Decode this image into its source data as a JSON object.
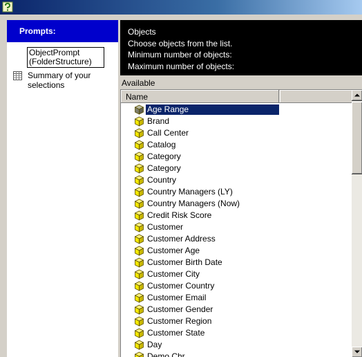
{
  "window": {
    "icon": "help-app-icon"
  },
  "sidebar": {
    "header": "Prompts:",
    "prompt_item": "ObjectPrompt (FolderStructure)",
    "summary": {
      "icon": "summary-grid-icon",
      "label": "Summary of your selections"
    }
  },
  "info": {
    "title": "Objects",
    "instruction": "Choose objects from the list.",
    "min_label": "Minimum number of objects:",
    "max_label": "Maximum number of objects:"
  },
  "list": {
    "available_label": "Available",
    "column_header": "Name",
    "selected_index": 0,
    "items": [
      "Age Range",
      "Brand",
      "Call Center",
      "Catalog",
      "Category",
      "Category",
      "Country",
      "Country Managers (LY)",
      "Country Managers (Now)",
      "Credit Risk Score",
      "Customer",
      "Customer Address",
      "Customer Age",
      "Customer Birth Date",
      "Customer City",
      "Customer Country",
      "Customer Email",
      "Customer Gender",
      "Customer Region",
      "Customer State",
      "Day",
      "Demo Chr..."
    ]
  },
  "colors": {
    "title_start": "#0a246a",
    "selection": "#0a246a",
    "prompts_header": "#0000cc",
    "cube_yellow": "#f2e600"
  }
}
